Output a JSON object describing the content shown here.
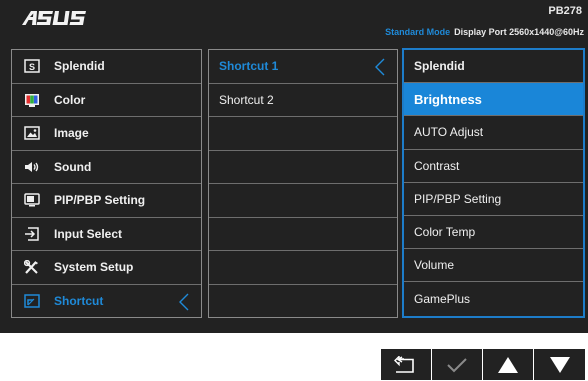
{
  "header": {
    "brand": "ASUS",
    "model": "PB278",
    "mode_label": "Standard Mode",
    "display_info": "Display Port  2560x1440@60Hz"
  },
  "main_menu": [
    {
      "label": "Splendid",
      "icon": "splendid-icon"
    },
    {
      "label": "Color",
      "icon": "color-icon"
    },
    {
      "label": "Image",
      "icon": "image-icon"
    },
    {
      "label": "Sound",
      "icon": "speaker-icon"
    },
    {
      "label": "PIP/PBP Setting",
      "icon": "pip-icon"
    },
    {
      "label": "Input Select",
      "icon": "input-select-icon"
    },
    {
      "label": "System Setup",
      "icon": "wrench-screwdriver-icon"
    },
    {
      "label": "Shortcut",
      "icon": "shortcut-icon",
      "active": true
    }
  ],
  "submenu": [
    {
      "label": "Shortcut 1",
      "active": true
    },
    {
      "label": "Shortcut 2"
    },
    {
      "label": ""
    },
    {
      "label": ""
    },
    {
      "label": ""
    },
    {
      "label": ""
    },
    {
      "label": ""
    },
    {
      "label": ""
    }
  ],
  "options": [
    {
      "label": "Splendid"
    },
    {
      "label": "Brightness",
      "selected": true
    },
    {
      "label": "AUTO Adjust"
    },
    {
      "label": "Contrast"
    },
    {
      "label": "PIP/PBP Setting"
    },
    {
      "label": "Color Temp"
    },
    {
      "label": "Volume"
    },
    {
      "label": "GamePlus"
    }
  ],
  "buttons": [
    {
      "name": "back-icon"
    },
    {
      "name": "check-icon"
    },
    {
      "name": "up-arrow-icon"
    },
    {
      "name": "down-arrow-icon"
    }
  ],
  "colors": {
    "accent": "#1f8ad8",
    "highlight": "#1a86d8",
    "background": "#222222"
  }
}
